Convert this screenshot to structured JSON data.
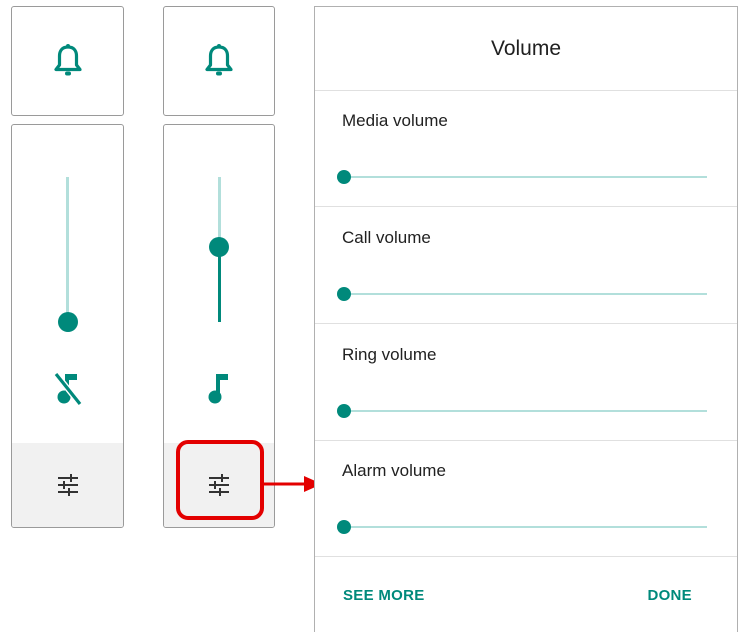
{
  "panel_a": {
    "bell_icon": "bell-icon",
    "slider_level": 0,
    "mode_icon": "music-note-off-icon",
    "settings_icon": "tune-icon"
  },
  "panel_b": {
    "bell_icon": "bell-icon",
    "slider_level": 0.5,
    "mode_icon": "music-note-icon",
    "settings_icon": "tune-icon",
    "highlighted": true
  },
  "dialog": {
    "title": "Volume",
    "rows": [
      {
        "label": "Media volume",
        "level": 0
      },
      {
        "label": "Call volume",
        "level": 0
      },
      {
        "label": "Ring volume",
        "level": 0
      },
      {
        "label": "Alarm volume",
        "level": 0
      }
    ],
    "see_more_label": "SEE MORE",
    "done_label": "DONE"
  },
  "colors": {
    "accent": "#00897b",
    "track": "#b2dfdb",
    "highlight": "#e30000"
  }
}
